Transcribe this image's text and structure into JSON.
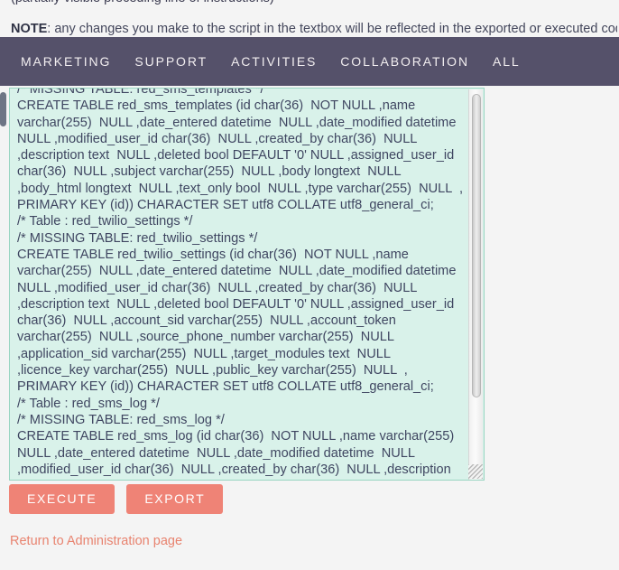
{
  "page": {
    "background_color": "#f4f4f4",
    "clipped_top_text": "(partially visible preceding line of instructions)"
  },
  "note": {
    "label": "NOTE",
    "separator": ":",
    "text": " any changes you make to the script in the textbox will be reflected in the exported or executed code."
  },
  "navbar": {
    "background_color": "#55516a",
    "text_color": "#f2eef0",
    "items": [
      {
        "label": "MARKETING"
      },
      {
        "label": "SUPPORT"
      },
      {
        "label": "ACTIVITIES"
      },
      {
        "label": "COLLABORATION"
      },
      {
        "label": "ALL"
      }
    ]
  },
  "script_box": {
    "background_color": "#d9f2ea",
    "border_color": "#9ad5c2",
    "text_color": "#3f4661",
    "content": "/* MISSING TABLE: red_sms_templates */\nCREATE TABLE red_sms_templates (id char(36)  NOT NULL ,name varchar(255)  NULL ,date_entered datetime  NULL ,date_modified datetime  NULL ,modified_user_id char(36)  NULL ,created_by char(36)  NULL ,description text  NULL ,deleted bool DEFAULT '0' NULL ,assigned_user_id char(36)  NULL ,subject varchar(255)  NULL ,body longtext  NULL ,body_html longtext  NULL ,text_only bool  NULL ,type varchar(255)  NULL  , PRIMARY KEY (id)) CHARACTER SET utf8 COLLATE utf8_general_ci;\n/* Table : red_twilio_settings */\n/* MISSING TABLE: red_twilio_settings */\nCREATE TABLE red_twilio_settings (id char(36)  NOT NULL ,name varchar(255)  NULL ,date_entered datetime  NULL ,date_modified datetime  NULL ,modified_user_id char(36)  NULL ,created_by char(36)  NULL ,description text  NULL ,deleted bool DEFAULT '0' NULL ,assigned_user_id char(36)  NULL ,account_sid varchar(255)  NULL ,account_token varchar(255)  NULL ,source_phone_number varchar(255)  NULL ,application_sid varchar(255)  NULL ,target_modules text  NULL ,licence_key varchar(255)  NULL ,public_key varchar(255)  NULL  , PRIMARY KEY (id)) CHARACTER SET utf8 COLLATE utf8_general_ci;\n/* Table : red_sms_log */\n/* MISSING TABLE: red_sms_log */\nCREATE TABLE red_sms_log (id char(36)  NOT NULL ,name varchar(255)  NULL ,date_entered datetime  NULL ,date_modified datetime  NULL ,modified_user_id char(36)  NULL ,created_by char(36)  NULL ,description text  NULL ,deleted bool DEFAULT '0' NULL ,assigned_user_id char(36)  NULL ,message text  NULL"
  },
  "buttons": {
    "color": "#ef8376",
    "execute_label": "EXECUTE",
    "export_label": "EXPORT"
  },
  "footer": {
    "return_link_label": "Return to Administration page",
    "return_link_color": "#e8836f"
  }
}
